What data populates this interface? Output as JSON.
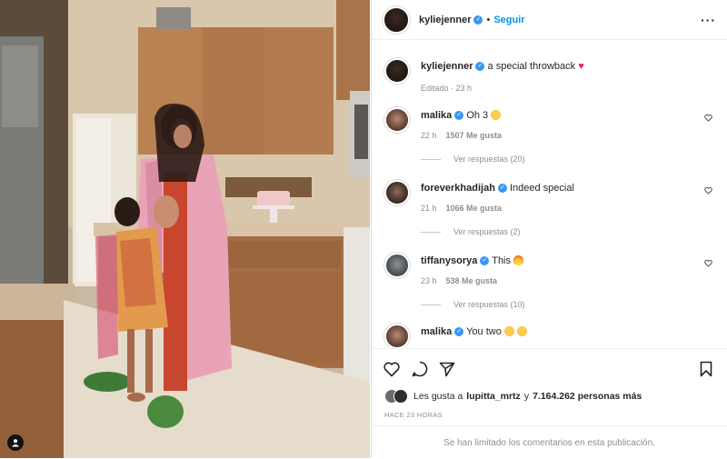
{
  "post": {
    "author": "kyliejenner",
    "follow_label": "Seguir",
    "caption_user": "kyliejenner",
    "caption_text": "a special throwback",
    "caption_meta": "Editado · 23 h"
  },
  "comments": [
    {
      "user": "malika",
      "text": "Oh 3",
      "time": "22 h",
      "likes": "1507 Me gusta",
      "replies": "Ver respuestas (20)",
      "emoji": "heart-eyes-emoji"
    },
    {
      "user": "foreverkhadijah",
      "text": "Indeed special",
      "time": "21 h",
      "likes": "1066 Me gusta",
      "replies": "Ver respuestas (2)",
      "emoji": ""
    },
    {
      "user": "tiffanysorya",
      "text": "This",
      "time": "23 h",
      "likes": "538 Me gusta",
      "replies": "Ver respuestas (10)",
      "emoji": "fire-emoji"
    },
    {
      "user": "malika",
      "text": "You two",
      "time": "",
      "likes": "",
      "replies": "",
      "emoji": "heart-eyes-emoji"
    }
  ],
  "likes_line": {
    "prefix": "Les gusta a",
    "user": "lupitta_mrtz",
    "middle": "y",
    "count": "7.164.262 personas más"
  },
  "posted_ago": "HACE 23 HORAS",
  "comments_limited": "Se han limitado los comentarios en esta publicación.",
  "colors": {
    "accent": "#0095f6",
    "verified": "#3897f0",
    "caption_heart": "#e0245e"
  }
}
